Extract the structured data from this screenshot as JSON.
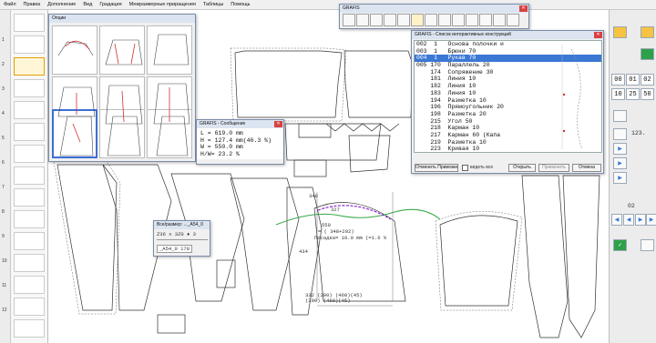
{
  "menu": [
    "Файл",
    "Правка",
    "Дополнение",
    "Вид",
    "Градация",
    "Межразмерные приращения",
    "Таблицы",
    "Помощь"
  ],
  "left_toolbar_numbers": [
    "1",
    "2",
    "3",
    "4",
    "5",
    "6",
    "7",
    "8",
    "9",
    "10",
    "11",
    "12"
  ],
  "options_window": {
    "title": "Опции"
  },
  "message_window": {
    "title": "GRAFIS - Сообщение",
    "lines": [
      "L   = 619.0 mm",
      "H   = 127.4 mm(46.3 %)",
      "W   = 550.0 mm",
      "H/W=  23.2 %"
    ]
  },
  "toolbar_window": {
    "title": "GRAFIS"
  },
  "size_window": {
    "title": "Все/размер: ..._A54_0",
    "row1": "Z36 ≡ 3Z0 ♦ 3",
    "row2": "_A54_0   178"
  },
  "constructions_window": {
    "title": "GRAFIS - Список интерактивных конструкций",
    "items": [
      "002  1   Основа полочки и",
      "003  1   Брюки 70",
      "004  1   Рукав 70",
      "005 170  Параллель 20",
      "    174  Сопряжение 30",
      "    181  Линия 10",
      "    182  Линия 10",
      "    183  Линия 10",
      "    194  Разметка 10",
      "    196  Прямоугольник 20",
      "    198  Разметка 20",
      "    215  Угол 50",
      "    218  Карман 10",
      "    217  Карман 60 (Капа",
      "    219  Разметка 10",
      "    223  Кривая 10"
    ],
    "selected_index": 2,
    "cancel_link_label": "Отменить Привязки",
    "show_all_label": "видеть все",
    "open_label": "Открыть",
    "apply_label": "Применить",
    "cancel_label": "Отмена"
  },
  "canvas_labels": {
    "dim_348": "348",
    "dim_327": "327",
    "dim_550": "550",
    "eq_line": "= ( 348+202)",
    "posadka": "Посадка= 10.0 mm (=1.6 %",
    "dim_434": "434",
    "bottom_dims": "332  (290)  (460)(45)",
    "bottom_dims2": "    (290)  (460)(45)"
  },
  "right_panel": {
    "numbers": [
      "00",
      "01",
      "25",
      "50"
    ],
    "scale_label": "123.",
    "page_label": "02"
  },
  "colors": {
    "accent_green": "#2fa04a",
    "accent_blue": "#3a78d4",
    "curve_green": "#3aa84a",
    "curve_purple": "#8a2bd0",
    "highlight_red": "#d23030"
  }
}
